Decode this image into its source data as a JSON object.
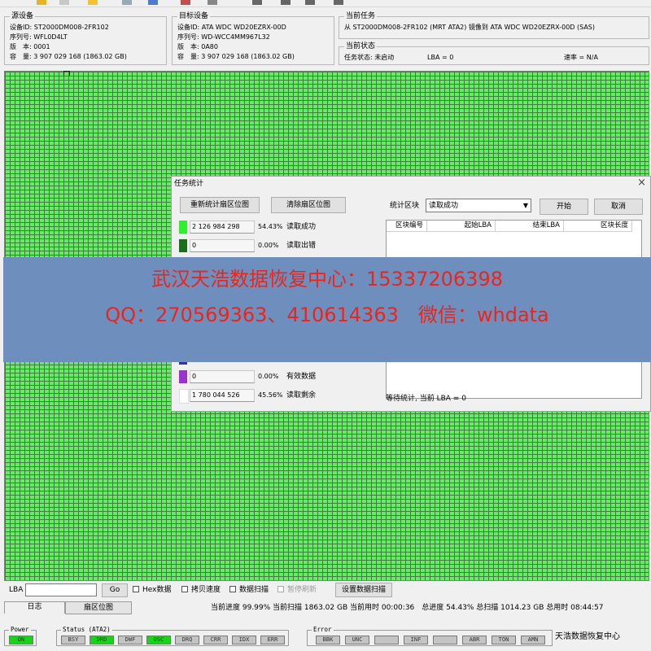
{
  "source_device": {
    "title": "源设备",
    "device_id": "设备ID: ST2000DM008-2FR102",
    "serial": "序列号: WFL0D4LT",
    "version": "版　本: 0001",
    "capacity": "容　量: 3 907 029 168 (1863.02 GB)"
  },
  "target_device": {
    "title": "目标设备",
    "device_id": "设备ID: ATA WDC WD20EZRX-00D",
    "serial": "序列号: WD-WCC4MM967L32",
    "version": "版　本: 0A80",
    "capacity": "容　量: 3 907 029 168 (1863.02 GB)"
  },
  "current_task": {
    "title": "当前任务",
    "text": "从 ST2000DM008-2FR102 (MRT ATA2) 镜像到 ATA WDC WD20EZRX-00D (SAS)"
  },
  "current_status": {
    "title": "当前状态",
    "task_state": "任务状态: 未启动",
    "lba": "LBA = 0",
    "rate": "速率 = N/A"
  },
  "dialog": {
    "title": "任务统计",
    "recalc_button": "重新统计扇区位图",
    "clear_button": "清除扇区位图",
    "block_label": "统计区块",
    "block_select": "读取成功",
    "start_button": "开始",
    "cancel_button": "取消",
    "table_headers": [
      "区块编号",
      "起始LBA",
      "结束LBA",
      "区块长度"
    ],
    "stats": [
      {
        "count": "2 126 984 298",
        "percent": "54.43%",
        "name": "读取成功",
        "color": "#2ff02f"
      },
      {
        "count": "0",
        "percent": "0.00%",
        "name": "读取出错",
        "color": "#1b6e1b"
      },
      {
        "count": "0",
        "percent": "0.00%",
        "name": "有效数据",
        "color": "#9933cc"
      },
      {
        "count": "1 780 044 526",
        "percent": "45.56%",
        "name": "读取剩余",
        "color": "#ffffff"
      }
    ],
    "footer": "等待统计, 当前 LBA = 0"
  },
  "watermark": {
    "line1": "武汉天浩数据恢复中心：15337206398",
    "line2": "QQ：270569363、410614363　微信：whdata"
  },
  "controls": {
    "lba_label": "LBA",
    "lba_value": "",
    "go_button": "Go",
    "hex_label": "Hex数据",
    "copy_speed_label": "拷贝速度",
    "data_scan_label": "数据扫描",
    "pause_refresh_label": "暂停刷新",
    "set_scan_button": "设置数据扫描"
  },
  "tabs": [
    "日志",
    "扇区位图"
  ],
  "progress_line": "当前进度 99.99% 当前扫描 1863.02 GB 当前用时 00:00:36　总进度 54.43% 总扫描 1014.23 GB 总用时 08:44:57",
  "power_panel": {
    "title": "Power",
    "indicators": [
      {
        "label": "ON",
        "on": true
      }
    ]
  },
  "status_panel": {
    "title": "Status (ATA2)",
    "indicators": [
      {
        "label": "BSY",
        "on": false
      },
      {
        "label": "DRD",
        "on": true
      },
      {
        "label": "DWF",
        "on": false
      },
      {
        "label": "DSC",
        "on": true
      },
      {
        "label": "DRQ",
        "on": false
      },
      {
        "label": "CRR",
        "on": false
      },
      {
        "label": "IDX",
        "on": false
      },
      {
        "label": "ERR",
        "on": false
      }
    ]
  },
  "error_panel": {
    "title": "Error",
    "indicators": [
      {
        "label": "BBK",
        "on": false
      },
      {
        "label": "UNC",
        "on": false
      },
      {
        "label": "",
        "on": false
      },
      {
        "label": "INF",
        "on": false
      },
      {
        "label": "",
        "on": false
      },
      {
        "label": "ABR",
        "on": false
      },
      {
        "label": "TON",
        "on": false
      },
      {
        "label": "AMN",
        "on": false
      }
    ]
  },
  "brand_label": "天浩数据恢复中心",
  "colors": {
    "map_green": "#5cf25c",
    "banner_blue": "#6e8fbe",
    "watermark_red": "#e8261c",
    "indicator_on": "#19d219"
  }
}
